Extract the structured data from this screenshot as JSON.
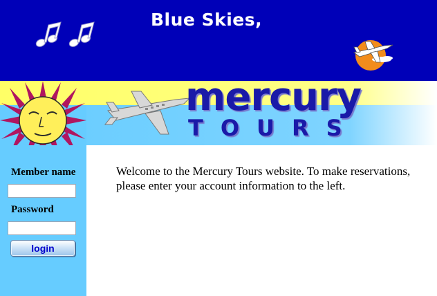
{
  "banner": {
    "title": "Blue Skies,",
    "background": "#0000b8",
    "icons": [
      "music-notes-icon",
      "airplane-sun-logo-icon"
    ]
  },
  "brand": {
    "name": "mercury",
    "tagline": "TOURS",
    "color": "#1a1aa8",
    "icons": [
      "sun-icon",
      "airplane-icon"
    ]
  },
  "login": {
    "member_label": "Member name",
    "member_value": "",
    "password_label": "Password",
    "password_value": "",
    "button_label": "login",
    "panel_color": "#66ccff"
  },
  "main": {
    "welcome_text": "Welcome to the Mercury Tours website. To make reservations, please enter your account information to the left."
  }
}
